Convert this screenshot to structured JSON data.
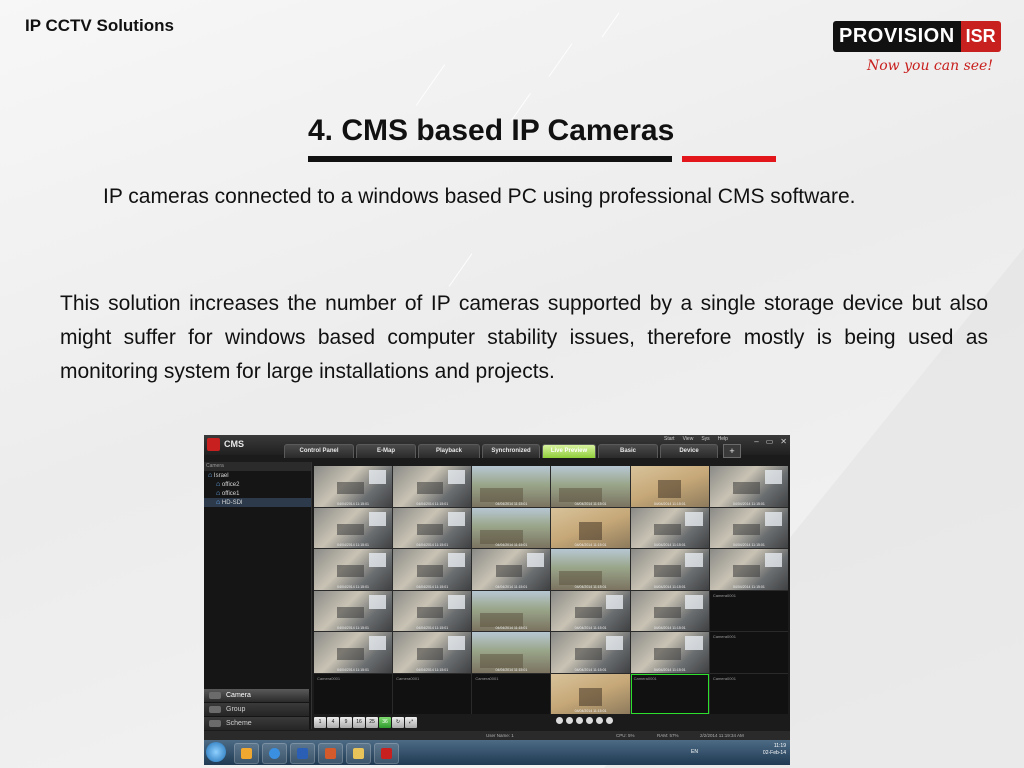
{
  "slide": {
    "header_title": "IP CCTV Solutions",
    "logo": {
      "brand": "PROVISION",
      "suffix": "ISR",
      "tagline": "Now you can see!"
    },
    "title": "4. CMS based IP Cameras",
    "subparagraph": "IP cameras connected to a windows based PC using professional CMS software.",
    "paragraph": "This solution increases the number of IP cameras supported by a single storage device but also might suffer for windows based computer stability issues, therefore mostly is being used as monitoring system for large installations and projects.",
    "colors": {
      "accent_red": "#e3161c",
      "rule_black": "#111111",
      "brand_red": "#c8201e"
    }
  },
  "cms": {
    "app_name": "CMS",
    "menu": [
      "Start",
      "View",
      "Sys",
      "Help"
    ],
    "window_buttons": [
      "–",
      "▭",
      "✕"
    ],
    "tabs": [
      {
        "label": "Control Panel",
        "active": false
      },
      {
        "label": "E-Map",
        "active": false
      },
      {
        "label": "Playback",
        "active": false
      },
      {
        "label": "Synchronized",
        "active": false
      },
      {
        "label": "Live Preview",
        "active": true
      },
      {
        "label": "Basic",
        "active": false
      },
      {
        "label": "Device",
        "active": false
      }
    ],
    "tab_add": "+",
    "sidebar": {
      "header": "Camera",
      "tree": [
        {
          "label": "Israel",
          "level": 0
        },
        {
          "label": "office2",
          "level": 1
        },
        {
          "label": "office1",
          "level": 1
        },
        {
          "label": "HD-SDI",
          "level": 1,
          "selected": true
        }
      ],
      "nav": [
        {
          "label": "Camera",
          "active": true
        },
        {
          "label": "Group",
          "active": false
        },
        {
          "label": "Scheme",
          "active": false
        }
      ]
    },
    "grid_tiles": [
      "f",
      "f",
      "o",
      "o",
      "w",
      "f",
      "f",
      "f",
      "o",
      "w",
      "f",
      "f",
      "f",
      "f",
      "f",
      "o",
      "f",
      "f",
      "f",
      "f",
      "o",
      "f",
      "f",
      "b",
      "f",
      "f",
      "o",
      "f",
      "f",
      "b",
      "b",
      "b",
      "b",
      "w",
      "b",
      "b"
    ],
    "tile_timestamp": "04/04/2014 11:15:01",
    "empty_tile_label": "Camera0001",
    "toolbar_layouts": [
      "1",
      "4",
      "9",
      "16",
      "25",
      "36"
    ],
    "toolbar_active_layout": "36",
    "status": {
      "user": "User Name: 1",
      "cpu": "CPU: 5%",
      "ram": "RAM: 57%",
      "datetime": "2/2/2014 11:19:34 AM"
    },
    "taskbar": {
      "language": "EN",
      "clock_time": "11:19",
      "clock_date": "02-Feb-14"
    }
  }
}
